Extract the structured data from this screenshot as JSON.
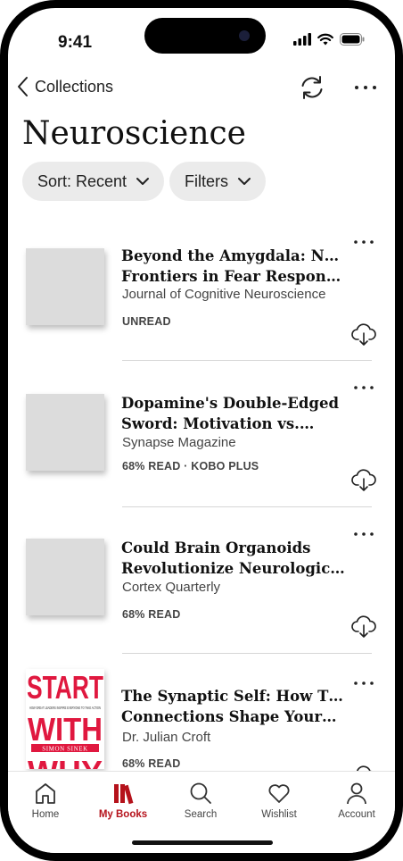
{
  "status_bar": {
    "time": "9:41"
  },
  "nav": {
    "back_label": "Collections"
  },
  "page": {
    "title": "Neuroscience"
  },
  "filters": {
    "sort_label": "Sort: Recent",
    "filters_label": "Filters"
  },
  "items": [
    {
      "title_line1": "Beyond the Amygdala: New",
      "title_line2": "Frontiers in Fear Respons…",
      "source": "Journal of Cognitive Neuroscience",
      "status": "UNREAD"
    },
    {
      "title_line1": "Dopamine's Double-Edged",
      "title_line2": "Sword: Motivation vs.…",
      "source": "Synapse Magazine",
      "status": "68% READ · KOBO PLUS"
    },
    {
      "title_line1": "Could Brain Organoids",
      "title_line2": "Revolutionize Neurologic…",
      "source": "Cortex Quarterly",
      "status": "68% READ"
    },
    {
      "title_line1": "The Synaptic Self: How Tiny",
      "title_line2": "Connections Shape Your…",
      "source": "Dr. Julian Croft",
      "status": "68% READ"
    }
  ],
  "book_cover": {
    "line1": "START",
    "line2": "WITH",
    "tagline": "HOW GREAT LEADERS INSPIRE EVERYONE TO TAKE ACTION",
    "author": "SIMON SINEK",
    "line3": "WHY"
  },
  "tabs": [
    {
      "label": "Home",
      "icon": "home-icon"
    },
    {
      "label": "My Books",
      "icon": "books-icon"
    },
    {
      "label": "Search",
      "icon": "search-icon"
    },
    {
      "label": "Wishlist",
      "icon": "heart-icon"
    },
    {
      "label": "Account",
      "icon": "user-icon"
    }
  ],
  "colors": {
    "accent": "#b5121b",
    "chip_bg": "#ebebeb",
    "cover_placeholder": "#dcdcdc"
  }
}
